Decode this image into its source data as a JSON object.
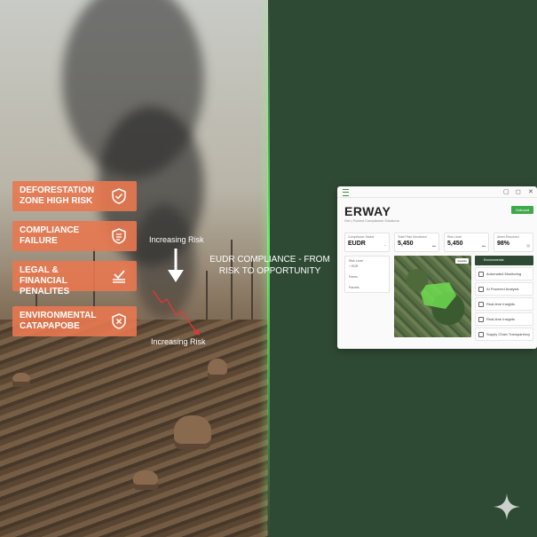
{
  "risks": [
    {
      "label": "DEFORESTATION ZONE HIGH RISK",
      "icon": "shield-check-icon"
    },
    {
      "label": "COMPLIANCE FAILURE",
      "icon": "document-icon"
    },
    {
      "label": "LEGAL & FINANCIAL PENALITES",
      "icon": "checklist-icon"
    },
    {
      "label": "ENVIRONMENTAL CATAPAPOBE",
      "icon": "shield-x-icon"
    }
  ],
  "arrows": {
    "top": "Increasing Risk",
    "bottom": "Increasing Risk"
  },
  "tagline": "EUDR COMPLIANCE - FROM RISK TO OPPORTUNITY",
  "app": {
    "brand": "ERWAY",
    "subtitle": "Get | Fueled Compliance Solutions",
    "button": "Onboard",
    "stats": [
      {
        "label": "Compliance Status",
        "value": "EUDR",
        "mini": "◔"
      },
      {
        "label": "Total Plots Monitored",
        "value": "5,450",
        "mini": "▬"
      },
      {
        "label": "Risk Level",
        "value": "5,450",
        "mini": "▬"
      },
      {
        "label": "Alerts Resolved",
        "value": "98%",
        "mini": "▤"
      }
    ],
    "left_panel": {
      "title": "Risk Level",
      "value": "+ EDR",
      "items": [
        "Farms",
        "Parcels"
      ]
    },
    "map_badge": "Satellite",
    "sidebar_head": "Environmental",
    "sidebar": [
      "Automated Monitoring",
      "AI Powered Analysis",
      "Real-time Insights",
      "Real-time Insights",
      "Supply Chain Transparency"
    ]
  },
  "colors": {
    "accent": "#3ea84a",
    "risk": "#e87850",
    "bg": "#2f4a34"
  }
}
